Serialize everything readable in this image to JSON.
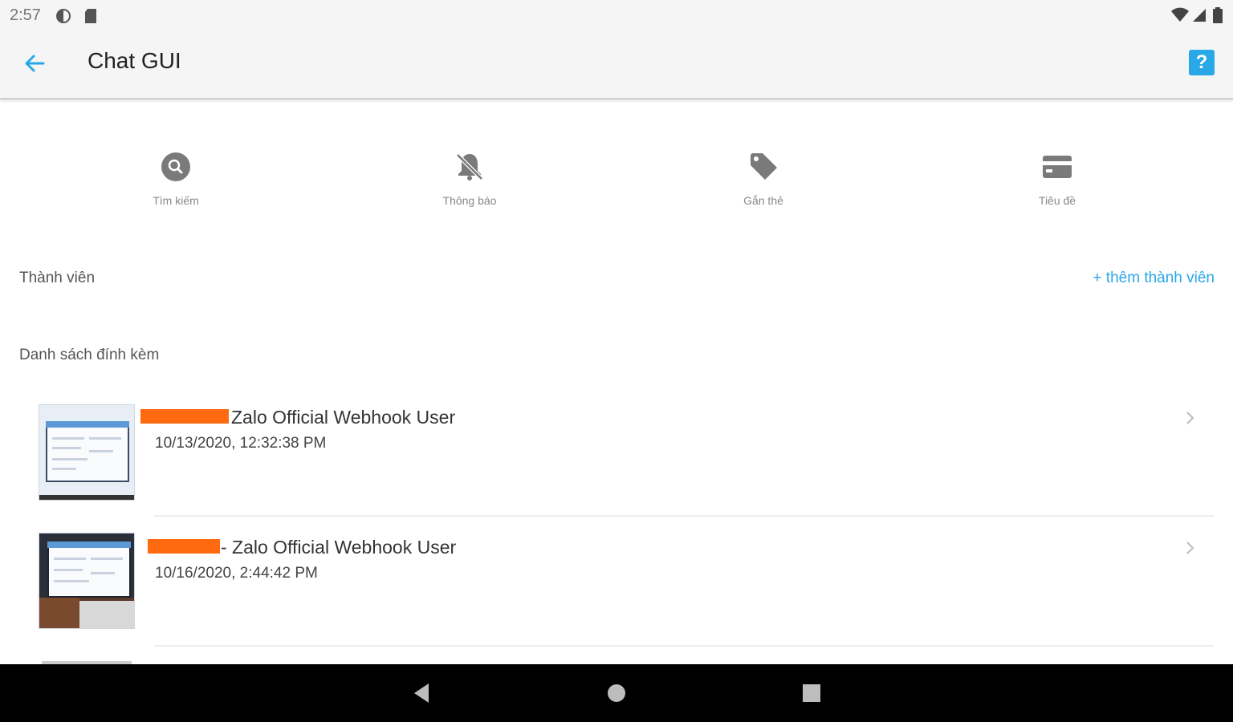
{
  "status_bar": {
    "time": "2:57"
  },
  "app_bar": {
    "title": "Chat GUI",
    "help_label": "?"
  },
  "actions": [
    {
      "label": "Tìm kiếm",
      "icon": "search-icon"
    },
    {
      "label": "Thông báo",
      "icon": "notifications-off-icon"
    },
    {
      "label": "Gắn thẻ",
      "icon": "tag-icon"
    },
    {
      "label": "Tiêu đề",
      "icon": "card-icon"
    }
  ],
  "members": {
    "label": "Thành viên",
    "add_label": "+ thêm thành viên"
  },
  "attachments": {
    "label": "Danh sách đính kèm",
    "items": [
      {
        "title": "Zalo Official Webhook User",
        "date": "10/13/2020, 12:32:38 PM"
      },
      {
        "title": "- Zalo Official Webhook User",
        "date": "10/16/2020, 2:44:42 PM"
      }
    ]
  },
  "colors": {
    "accent": "#29a8e8",
    "redaction": "#ff6a10",
    "icon_gray": "#7a7a7a"
  }
}
